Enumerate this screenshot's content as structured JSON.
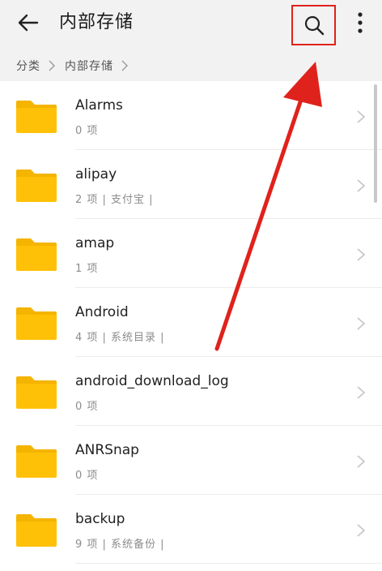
{
  "header": {
    "title": "内部存储",
    "back_icon": "back-arrow-icon",
    "search_icon": "search-icon",
    "more_icon": "more-vertical-icon"
  },
  "breadcrumb": {
    "items": [
      "分类",
      "内部存储"
    ]
  },
  "files": [
    {
      "name": "Alarms",
      "meta": "0 项"
    },
    {
      "name": "alipay",
      "meta": "2 项 | 支付宝 |"
    },
    {
      "name": "amap",
      "meta": "1 项"
    },
    {
      "name": "Android",
      "meta": "4 项 | 系统目录 |"
    },
    {
      "name": "android_download_log",
      "meta": "0 项"
    },
    {
      "name": "ANRSnap",
      "meta": "0 项"
    },
    {
      "name": "backup",
      "meta": "9 项 | 系统备份 |"
    }
  ],
  "colors": {
    "folder": "#FFC107",
    "folder_tab": "#F4B400",
    "annotation": "#E0221C"
  }
}
